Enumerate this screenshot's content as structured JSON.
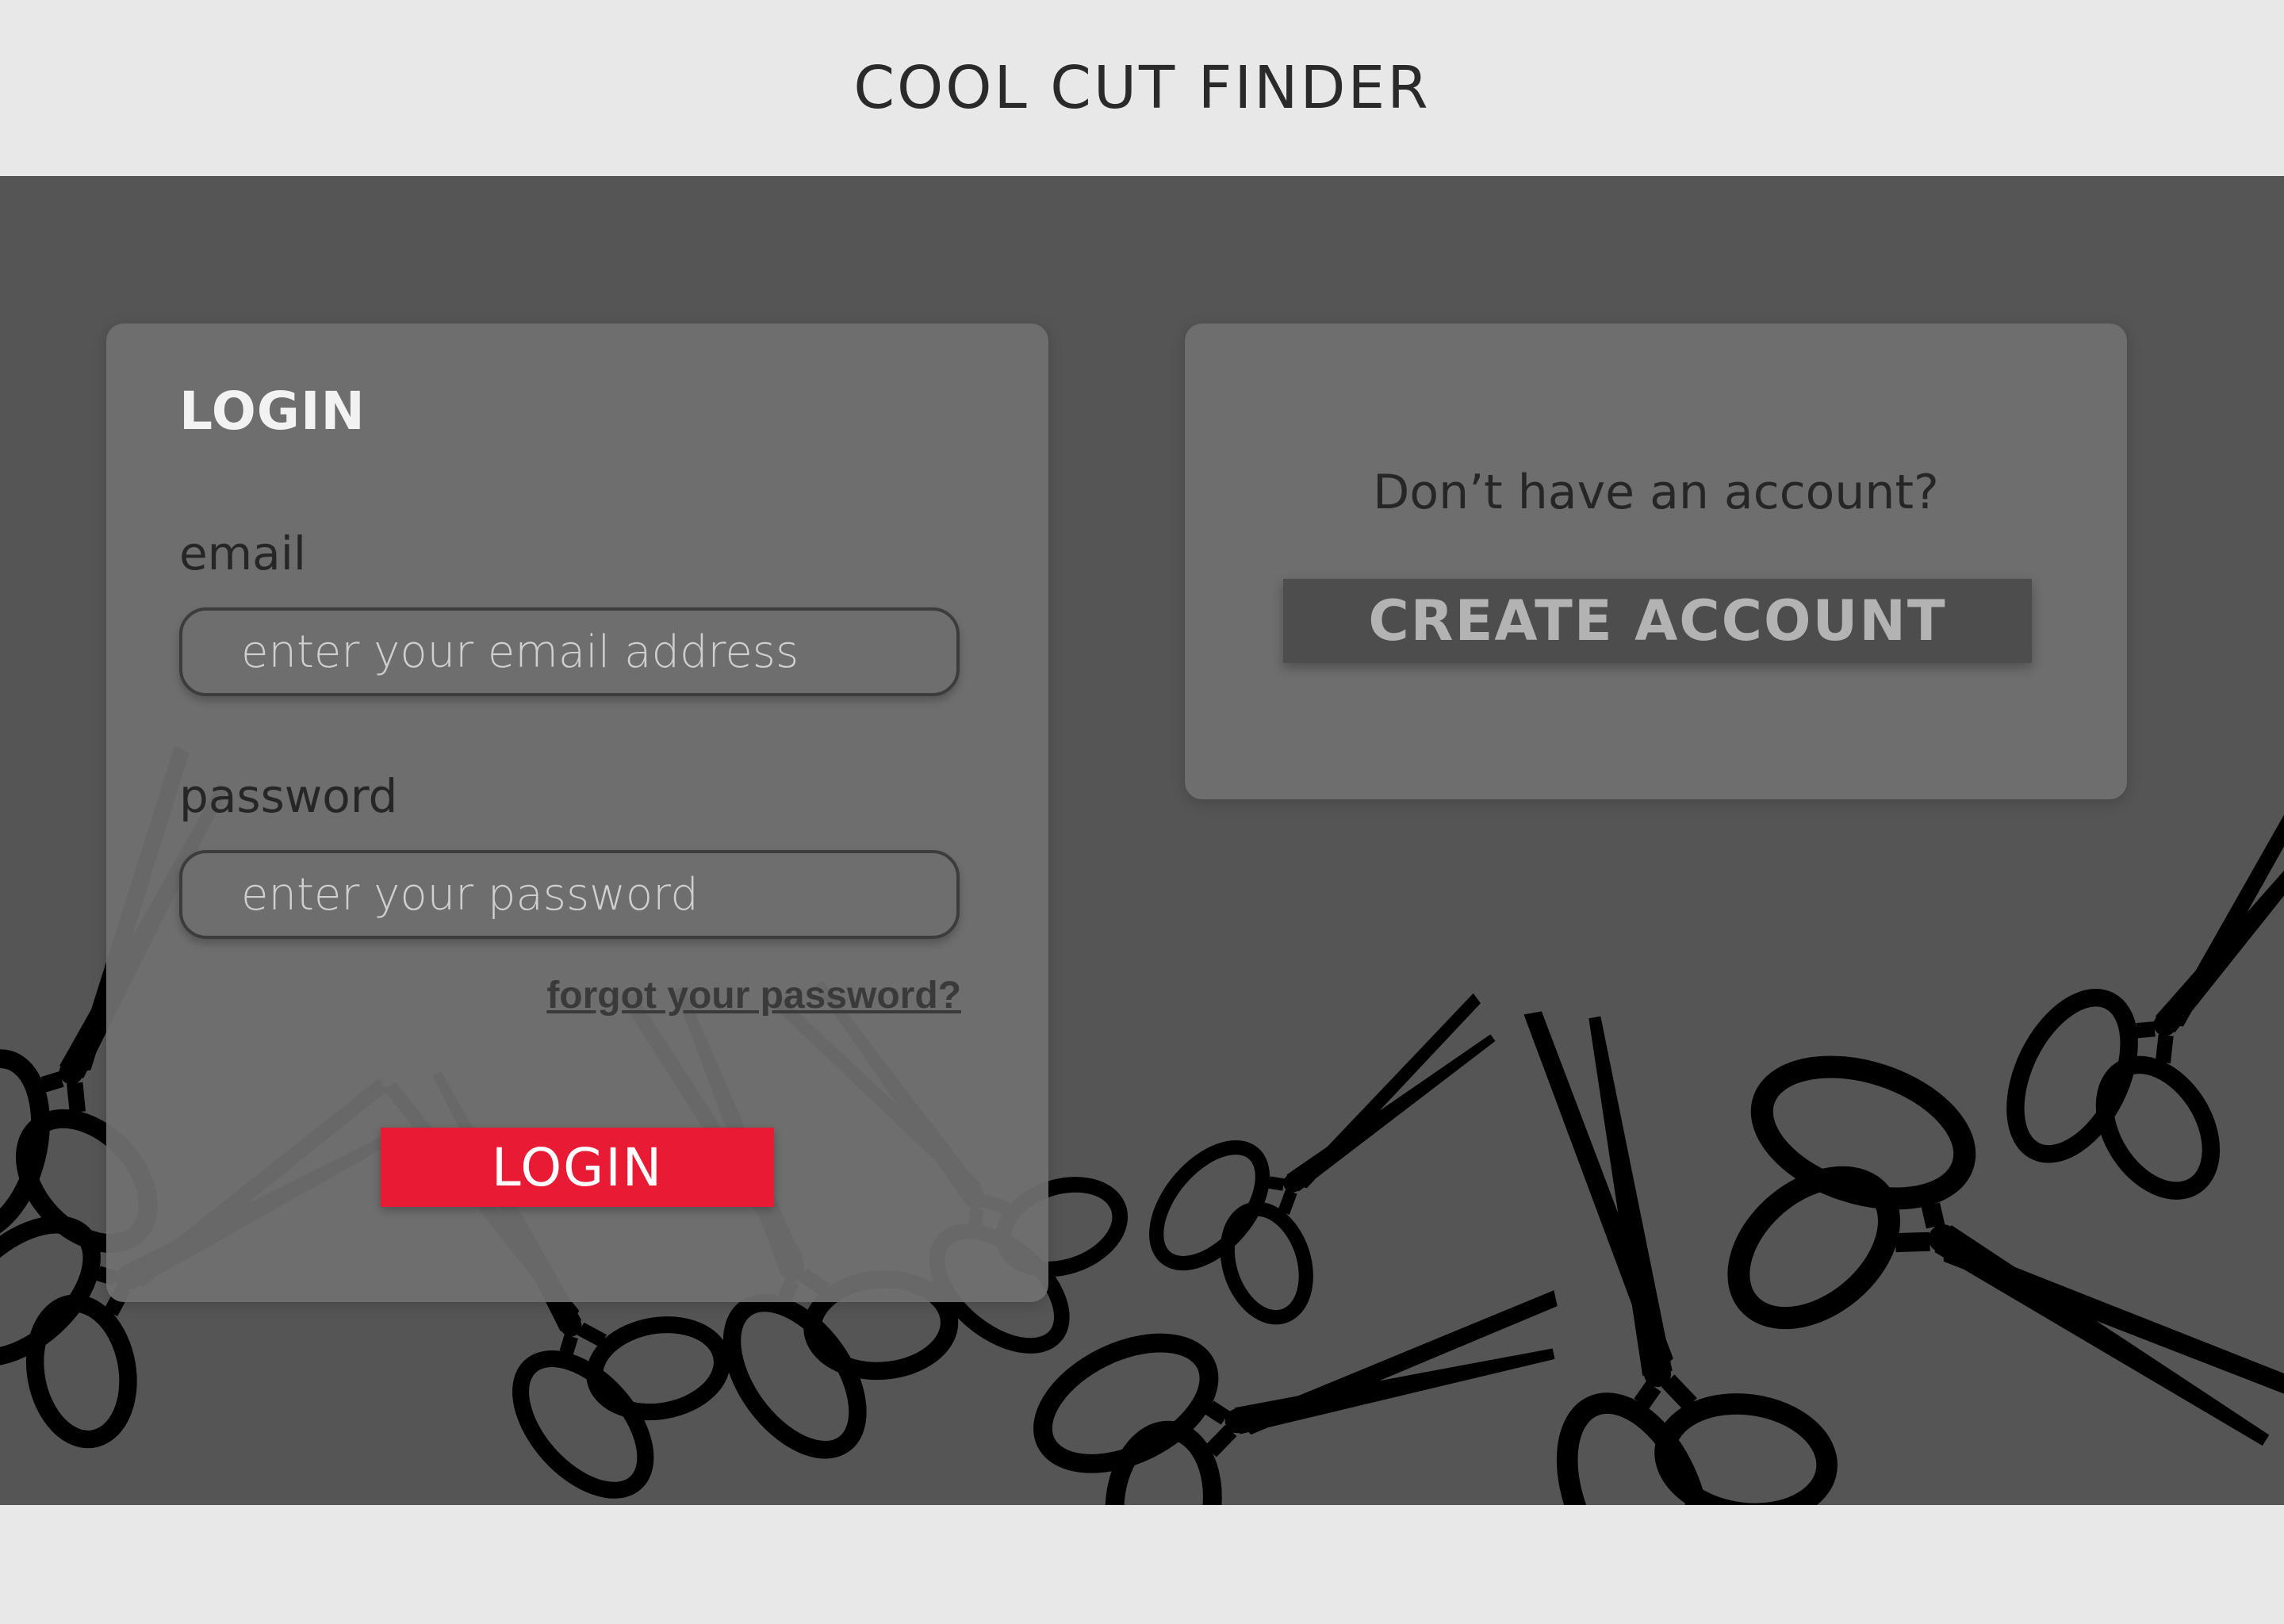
{
  "header": {
    "title": "COOL CUT FINDER"
  },
  "login": {
    "heading": "LOGIN",
    "email_label": "email",
    "email_placeholder": "enter your email address",
    "password_label": "password",
    "password_placeholder": "enter your password",
    "forgot_password": "forgot your password?",
    "button_label": "LOGIN"
  },
  "signup": {
    "question": "Don’t have an account?",
    "button_label": "CREATE ACCOUNT"
  },
  "icons": {
    "background_decoration": "scissors-icon"
  },
  "colors": {
    "header_bg": "#e8e8e8",
    "stage_bg": "#555555",
    "card_bg": "#707070",
    "login_button": "#e91a33",
    "create_button": "#4d4d4d",
    "scissors": "#000000"
  }
}
